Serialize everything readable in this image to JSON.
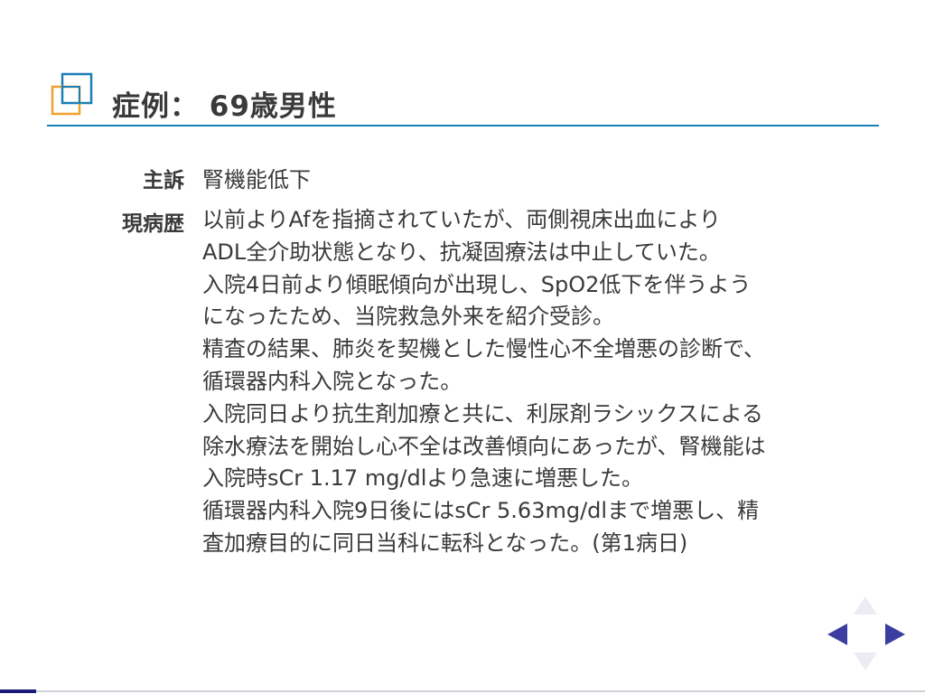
{
  "slide": {
    "title": "症例： 69歳男性",
    "colors": {
      "accent_blue": "#1a7fb5",
      "accent_orange": "#f0a030",
      "nav_active": "#3b3da0",
      "nav_inactive": "#ececf4"
    }
  },
  "chief_complaint": {
    "label": "主訴",
    "value": "腎機能低下"
  },
  "present_illness": {
    "label": "現病歴",
    "lines": [
      "以前よりAfを指摘されていたが、両側視床出血により",
      "ADL全介助状態となり、抗凝固療法は中止していた。",
      "入院4日前より傾眠傾向が出現し、SpO2低下を伴うよう",
      "になったため、当院救急外来を紹介受診。",
      "精査の結果、肺炎を契機とした慢性心不全増悪の診断で、",
      "循環器内科入院となった。",
      "入院同日より抗生剤加療と共に、利尿剤ラシックスによる",
      "除水療法を開始し心不全は改善傾向にあったが、腎機能は",
      "入院時sCr 1.17 mg/dlより急速に増悪した。",
      "循環器内科入院9日後にはsCr 5.63mg/dlまで増悪し、精",
      "査加療目的に同日当科に転科となった。(第1病日)"
    ]
  },
  "navigation": {
    "icons": [
      "arrow-up-icon",
      "arrow-left-icon",
      "arrow-right-icon",
      "arrow-down-icon"
    ]
  }
}
